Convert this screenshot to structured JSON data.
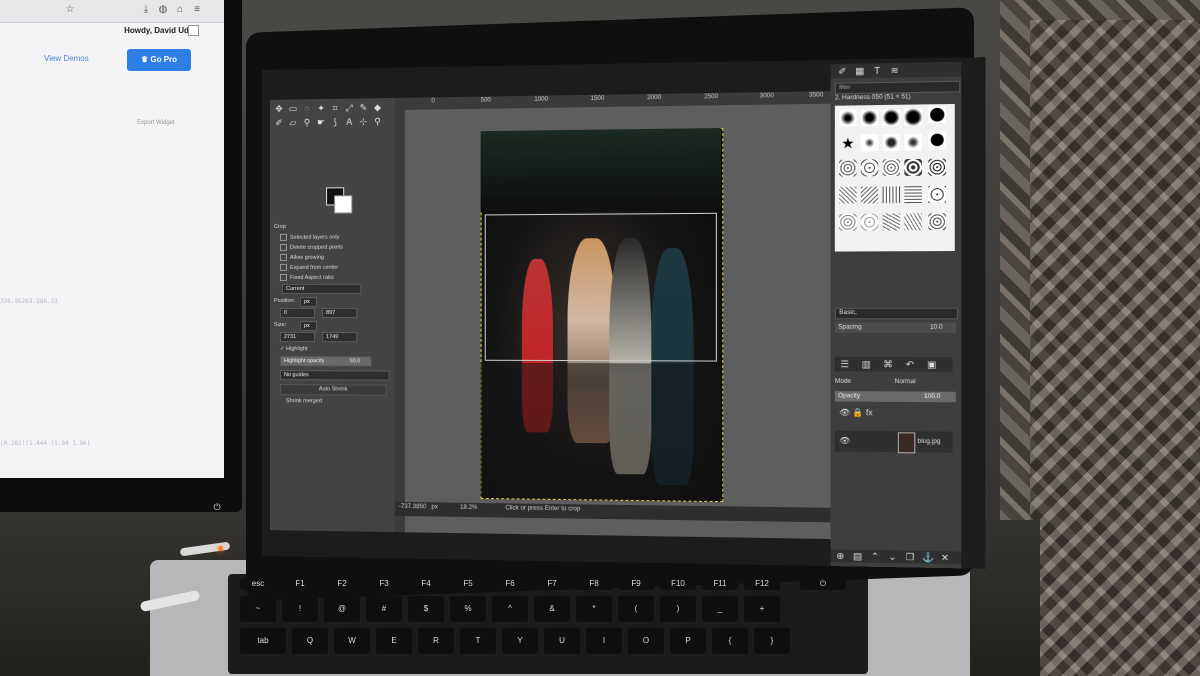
{
  "external_monitor": {
    "greeting": "Howdy, David Udo.",
    "view_demos": "View Demos",
    "go_pro": "Go Pro",
    "export_widget": "Export Widget",
    "code_line_1": "326.95263.286.23",
    "code_line_2": "(0.282)(1.444 (1.94 1.96)"
  },
  "gimp": {
    "crop_title": "Crop",
    "options": {
      "selected_layers_only": "Selected layers only",
      "delete_cropped_pixels": "Delete cropped pixels",
      "allow_growing": "Allow growing",
      "expand_from_center": "Expand from center",
      "fixed_aspect_ratio": "Fixed  Aspect ratio",
      "current": "Current",
      "position_label": "Position:",
      "position_unit": "px",
      "position_x": "0",
      "position_y": "897",
      "size_label": "Size:",
      "size_unit": "px",
      "size_w": "2731",
      "size_h": "1749",
      "highlight": "Highlight",
      "highlight_opacity_label": "Highlight opacity",
      "highlight_opacity_value": "50.0",
      "no_guides": "No guides",
      "auto_shrink": "Auto Shrink",
      "shrink_merged": "Shrink merged"
    },
    "ruler_labels": [
      "0",
      "500",
      "1000",
      "1500",
      "2000",
      "2500",
      "3000",
      "3500"
    ],
    "status": {
      "coordinates": "-737.3850",
      "unit": "px",
      "zoom": "18.2%",
      "message": "Click or press Enter to crop"
    },
    "dock": {
      "filter_placeholder": "filter",
      "brush_title": "2. Hardness 050 (51 × 51)",
      "brush_set": "Basic,",
      "spacing_label": "Spacing",
      "spacing_value": "10.0",
      "mode_label": "Mode",
      "mode_value": "Normal",
      "opacity_label": "Opacity",
      "opacity_value": "100.0",
      "layer_name": "blog.jpg"
    }
  },
  "keyboard": {
    "row1": [
      "esc",
      "F1",
      "F2",
      "F3",
      "F4",
      "F5",
      "F6",
      "F7",
      "F8",
      "F9",
      "F10",
      "F11",
      "F12"
    ],
    "row2": [
      "~",
      "!",
      "@",
      "#",
      "$",
      "%",
      "^",
      "&",
      "*",
      "(",
      ")",
      "_",
      "+"
    ],
    "row3": [
      "tab",
      "Q",
      "W",
      "E",
      "R",
      "T",
      "Y",
      "U",
      "I",
      "O",
      "P",
      "{",
      "}"
    ]
  }
}
